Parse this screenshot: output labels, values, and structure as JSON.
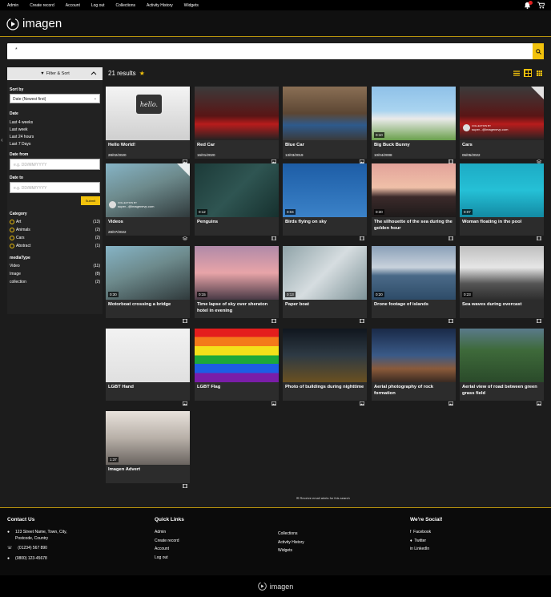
{
  "topnav": {
    "links": [
      "Admin",
      "Create record",
      "Account",
      "Log out",
      "Collections",
      "Activity History",
      "Widgets"
    ]
  },
  "brand": {
    "name": "imagen"
  },
  "search": {
    "value": "*"
  },
  "sidebar": {
    "header": "Filter & Sort",
    "sort_label": "Sort by",
    "sort_value": "Date (Newest first)",
    "date_label": "Date",
    "date_options": [
      "Last 4 weeks",
      "Last week",
      "Last 24 hours",
      "Last 7 Days"
    ],
    "date_from_label": "Date from",
    "date_to_label": "Date to",
    "date_placeholder": "e.g. DD/MM/YYYY",
    "submit": "Submit",
    "category_label": "Category",
    "categories": [
      {
        "name": "Art",
        "count": "(13)"
      },
      {
        "name": "Animals",
        "count": "(2)"
      },
      {
        "name": "Cars",
        "count": "(2)"
      },
      {
        "name": "Abstract",
        "count": "(1)"
      }
    ],
    "mediatype_label": "mediaType",
    "mediatypes": [
      {
        "name": "Video",
        "count": "(11)"
      },
      {
        "name": "Image",
        "count": "(8)"
      },
      {
        "name": "collection",
        "count": "(2)"
      }
    ]
  },
  "results": {
    "count_text": "21 results"
  },
  "cards": [
    {
      "title": "Hello World!",
      "date": "28/02/2020",
      "type": "image",
      "dur": "",
      "coll": ""
    },
    {
      "title": "Red Car",
      "date": "16/01/2020",
      "type": "image",
      "dur": "",
      "coll": ""
    },
    {
      "title": "Blue Car",
      "date": "13/03/2019",
      "type": "image",
      "dur": "",
      "coll": ""
    },
    {
      "title": "Big Buck Bunny",
      "date": "10/04/2008",
      "type": "video",
      "dur": "0:10",
      "coll": ""
    },
    {
      "title": "Cars",
      "date": "06/05/2022",
      "type": "collection",
      "dur": "",
      "coll": "super...@imagenevp.com"
    },
    {
      "title": "Videos",
      "date": "28/07/2022",
      "type": "collection",
      "dur": "",
      "coll": "super...@imagenevp.com"
    },
    {
      "title": "Penguins",
      "date": "",
      "type": "video",
      "dur": "0:12",
      "coll": ""
    },
    {
      "title": "Birds flying on sky",
      "date": "",
      "type": "video",
      "dur": "0:04",
      "coll": ""
    },
    {
      "title": "The silhouette of the sea during the golden hour",
      "date": "",
      "type": "video",
      "dur": "0:30",
      "coll": ""
    },
    {
      "title": "Woman floating in the pool",
      "date": "",
      "type": "video",
      "dur": "0:07",
      "coll": ""
    },
    {
      "title": "Motorboat crossing a bridge",
      "date": "",
      "type": "video",
      "dur": "0:30",
      "coll": ""
    },
    {
      "title": "Time lapse of sky over sheraton hotel in evening",
      "date": "",
      "type": "video",
      "dur": "0:15",
      "coll": ""
    },
    {
      "title": "Paper boat",
      "date": "",
      "type": "video",
      "dur": "0:13",
      "coll": ""
    },
    {
      "title": "Drone footage of islands",
      "date": "",
      "type": "video",
      "dur": "0:20",
      "coll": ""
    },
    {
      "title": "Sea waves during overcast",
      "date": "",
      "type": "video",
      "dur": "0:23",
      "coll": ""
    },
    {
      "title": "LGBT Hand",
      "date": "",
      "type": "image",
      "dur": "",
      "coll": ""
    },
    {
      "title": "LGBT Flag",
      "date": "",
      "type": "image",
      "dur": "",
      "coll": ""
    },
    {
      "title": "Photo of buildings during nighttime",
      "date": "",
      "type": "image",
      "dur": "",
      "coll": ""
    },
    {
      "title": "Aerial photography of rock formation",
      "date": "",
      "type": "image",
      "dur": "",
      "coll": ""
    },
    {
      "title": "Aerial view of road between green grass field",
      "date": "",
      "type": "image",
      "dur": "",
      "coll": ""
    },
    {
      "title": "Imagen Advert",
      "date": "",
      "type": "video",
      "dur": "1:37",
      "coll": ""
    }
  ],
  "collection_by_label": "COLLECTION BY",
  "thumb_hello_text": "hello.",
  "alerts": "Receive email alerts for this search",
  "footer": {
    "contact_title": "Contact Us",
    "address": "123 Street Name, Town, City, Postcode, Country",
    "phone1": "(01234) 567 890",
    "phone2": "(0800) 123-45678",
    "quicklinks_title": "Quick Links",
    "ql_col1": [
      "Admin",
      "Create record",
      "Account",
      "Log out"
    ],
    "ql_col2": [
      "Collections",
      "Activity History",
      "Widgets"
    ],
    "social_title": "We're Social!",
    "social": [
      "Facebook",
      "Twitter",
      "LinkedIn"
    ]
  }
}
